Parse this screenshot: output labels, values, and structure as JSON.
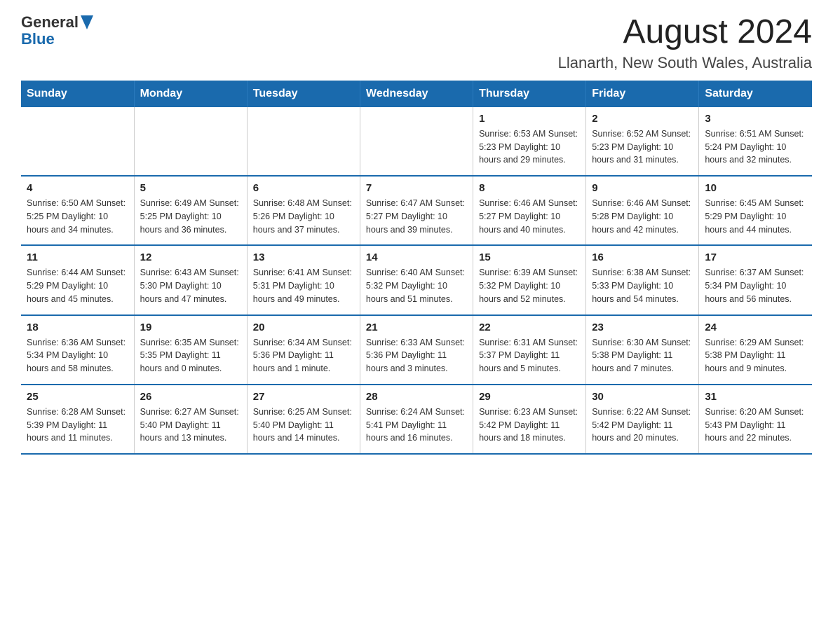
{
  "header": {
    "logo": {
      "general": "General",
      "blue": "Blue"
    },
    "title": "August 2024",
    "location": "Llanarth, New South Wales, Australia"
  },
  "weekdays": [
    "Sunday",
    "Monday",
    "Tuesday",
    "Wednesday",
    "Thursday",
    "Friday",
    "Saturday"
  ],
  "weeks": [
    [
      {
        "day": "",
        "info": ""
      },
      {
        "day": "",
        "info": ""
      },
      {
        "day": "",
        "info": ""
      },
      {
        "day": "",
        "info": ""
      },
      {
        "day": "1",
        "info": "Sunrise: 6:53 AM\nSunset: 5:23 PM\nDaylight: 10 hours and 29 minutes."
      },
      {
        "day": "2",
        "info": "Sunrise: 6:52 AM\nSunset: 5:23 PM\nDaylight: 10 hours and 31 minutes."
      },
      {
        "day": "3",
        "info": "Sunrise: 6:51 AM\nSunset: 5:24 PM\nDaylight: 10 hours and 32 minutes."
      }
    ],
    [
      {
        "day": "4",
        "info": "Sunrise: 6:50 AM\nSunset: 5:25 PM\nDaylight: 10 hours and 34 minutes."
      },
      {
        "day": "5",
        "info": "Sunrise: 6:49 AM\nSunset: 5:25 PM\nDaylight: 10 hours and 36 minutes."
      },
      {
        "day": "6",
        "info": "Sunrise: 6:48 AM\nSunset: 5:26 PM\nDaylight: 10 hours and 37 minutes."
      },
      {
        "day": "7",
        "info": "Sunrise: 6:47 AM\nSunset: 5:27 PM\nDaylight: 10 hours and 39 minutes."
      },
      {
        "day": "8",
        "info": "Sunrise: 6:46 AM\nSunset: 5:27 PM\nDaylight: 10 hours and 40 minutes."
      },
      {
        "day": "9",
        "info": "Sunrise: 6:46 AM\nSunset: 5:28 PM\nDaylight: 10 hours and 42 minutes."
      },
      {
        "day": "10",
        "info": "Sunrise: 6:45 AM\nSunset: 5:29 PM\nDaylight: 10 hours and 44 minutes."
      }
    ],
    [
      {
        "day": "11",
        "info": "Sunrise: 6:44 AM\nSunset: 5:29 PM\nDaylight: 10 hours and 45 minutes."
      },
      {
        "day": "12",
        "info": "Sunrise: 6:43 AM\nSunset: 5:30 PM\nDaylight: 10 hours and 47 minutes."
      },
      {
        "day": "13",
        "info": "Sunrise: 6:41 AM\nSunset: 5:31 PM\nDaylight: 10 hours and 49 minutes."
      },
      {
        "day": "14",
        "info": "Sunrise: 6:40 AM\nSunset: 5:32 PM\nDaylight: 10 hours and 51 minutes."
      },
      {
        "day": "15",
        "info": "Sunrise: 6:39 AM\nSunset: 5:32 PM\nDaylight: 10 hours and 52 minutes."
      },
      {
        "day": "16",
        "info": "Sunrise: 6:38 AM\nSunset: 5:33 PM\nDaylight: 10 hours and 54 minutes."
      },
      {
        "day": "17",
        "info": "Sunrise: 6:37 AM\nSunset: 5:34 PM\nDaylight: 10 hours and 56 minutes."
      }
    ],
    [
      {
        "day": "18",
        "info": "Sunrise: 6:36 AM\nSunset: 5:34 PM\nDaylight: 10 hours and 58 minutes."
      },
      {
        "day": "19",
        "info": "Sunrise: 6:35 AM\nSunset: 5:35 PM\nDaylight: 11 hours and 0 minutes."
      },
      {
        "day": "20",
        "info": "Sunrise: 6:34 AM\nSunset: 5:36 PM\nDaylight: 11 hours and 1 minute."
      },
      {
        "day": "21",
        "info": "Sunrise: 6:33 AM\nSunset: 5:36 PM\nDaylight: 11 hours and 3 minutes."
      },
      {
        "day": "22",
        "info": "Sunrise: 6:31 AM\nSunset: 5:37 PM\nDaylight: 11 hours and 5 minutes."
      },
      {
        "day": "23",
        "info": "Sunrise: 6:30 AM\nSunset: 5:38 PM\nDaylight: 11 hours and 7 minutes."
      },
      {
        "day": "24",
        "info": "Sunrise: 6:29 AM\nSunset: 5:38 PM\nDaylight: 11 hours and 9 minutes."
      }
    ],
    [
      {
        "day": "25",
        "info": "Sunrise: 6:28 AM\nSunset: 5:39 PM\nDaylight: 11 hours and 11 minutes."
      },
      {
        "day": "26",
        "info": "Sunrise: 6:27 AM\nSunset: 5:40 PM\nDaylight: 11 hours and 13 minutes."
      },
      {
        "day": "27",
        "info": "Sunrise: 6:25 AM\nSunset: 5:40 PM\nDaylight: 11 hours and 14 minutes."
      },
      {
        "day": "28",
        "info": "Sunrise: 6:24 AM\nSunset: 5:41 PM\nDaylight: 11 hours and 16 minutes."
      },
      {
        "day": "29",
        "info": "Sunrise: 6:23 AM\nSunset: 5:42 PM\nDaylight: 11 hours and 18 minutes."
      },
      {
        "day": "30",
        "info": "Sunrise: 6:22 AM\nSunset: 5:42 PM\nDaylight: 11 hours and 20 minutes."
      },
      {
        "day": "31",
        "info": "Sunrise: 6:20 AM\nSunset: 5:43 PM\nDaylight: 11 hours and 22 minutes."
      }
    ]
  ]
}
